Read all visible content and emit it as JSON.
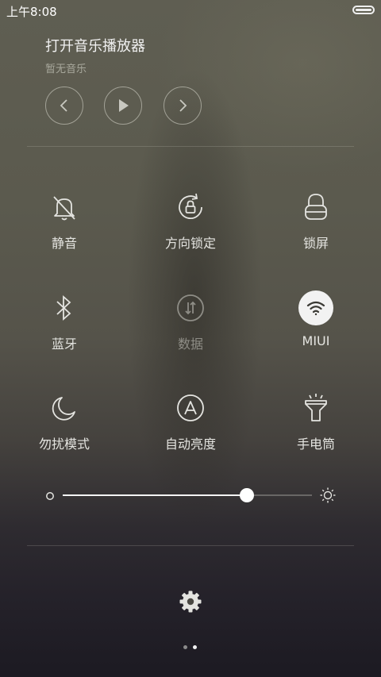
{
  "status_bar": {
    "time": "上午8:08",
    "battery_icon": "battery-full-icon"
  },
  "music": {
    "title": "打开音乐播放器",
    "subtitle": "暂无音乐",
    "controls": [
      "previous-icon",
      "play-icon",
      "next-icon"
    ]
  },
  "toggles": [
    {
      "label": "静音",
      "icon": "bell-muted-icon",
      "state": "off"
    },
    {
      "label": "方向锁定",
      "icon": "rotation-lock-icon",
      "state": "off"
    },
    {
      "label": "锁屏",
      "icon": "lock-icon",
      "state": "off"
    },
    {
      "label": "蓝牙",
      "icon": "bluetooth-icon",
      "state": "off"
    },
    {
      "label": "数据",
      "icon": "mobile-data-icon",
      "state": "disabled"
    },
    {
      "label": "MIUI",
      "icon": "wifi-icon",
      "state": "on"
    },
    {
      "label": "勿扰模式",
      "icon": "moon-icon",
      "state": "off"
    },
    {
      "label": "自动亮度",
      "icon": "auto-brightness-icon",
      "state": "off"
    },
    {
      "label": "手电筒",
      "icon": "flashlight-icon",
      "state": "off"
    }
  ],
  "brightness": {
    "level": 0.74
  },
  "pages": {
    "count": 2,
    "active_index": 1
  },
  "colors": {
    "active": "#f2f2f2",
    "inactive_dot": "#8a8a8a"
  }
}
